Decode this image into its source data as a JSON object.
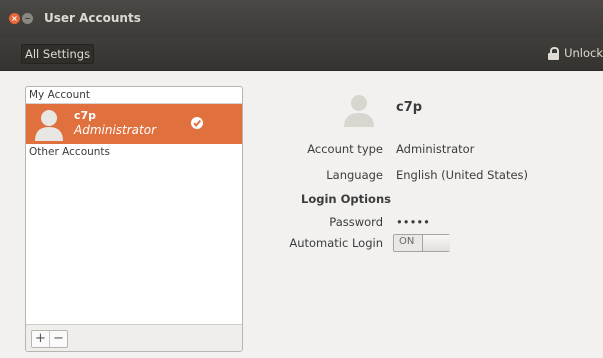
{
  "window": {
    "title": "User Accounts"
  },
  "toolbar": {
    "all_settings_label": "All Settings",
    "unlock_label": "Unlock"
  },
  "sidebar": {
    "my_account_header": "My Account",
    "selected_account": {
      "name": "c7p",
      "role": "Administrator"
    },
    "other_accounts_header": "Other Accounts",
    "add_label": "+",
    "remove_label": "−"
  },
  "details": {
    "user_name": "c7p",
    "account_type_label": "Account type",
    "account_type_value": "Administrator",
    "language_label": "Language",
    "language_value": "English (United States)",
    "login_options_label": "Login Options",
    "password_label": "Password",
    "password_value": "•••••",
    "automatic_login_label": "Automatic Login",
    "automatic_login_state": "ON"
  },
  "colors": {
    "accent": "#e0703e",
    "titlebar": "#3c3b37"
  },
  "icons": {
    "close": "close-icon",
    "minimize": "minimize-icon",
    "lock": "lock-icon",
    "avatar": "user-avatar-icon",
    "check": "check-icon"
  }
}
